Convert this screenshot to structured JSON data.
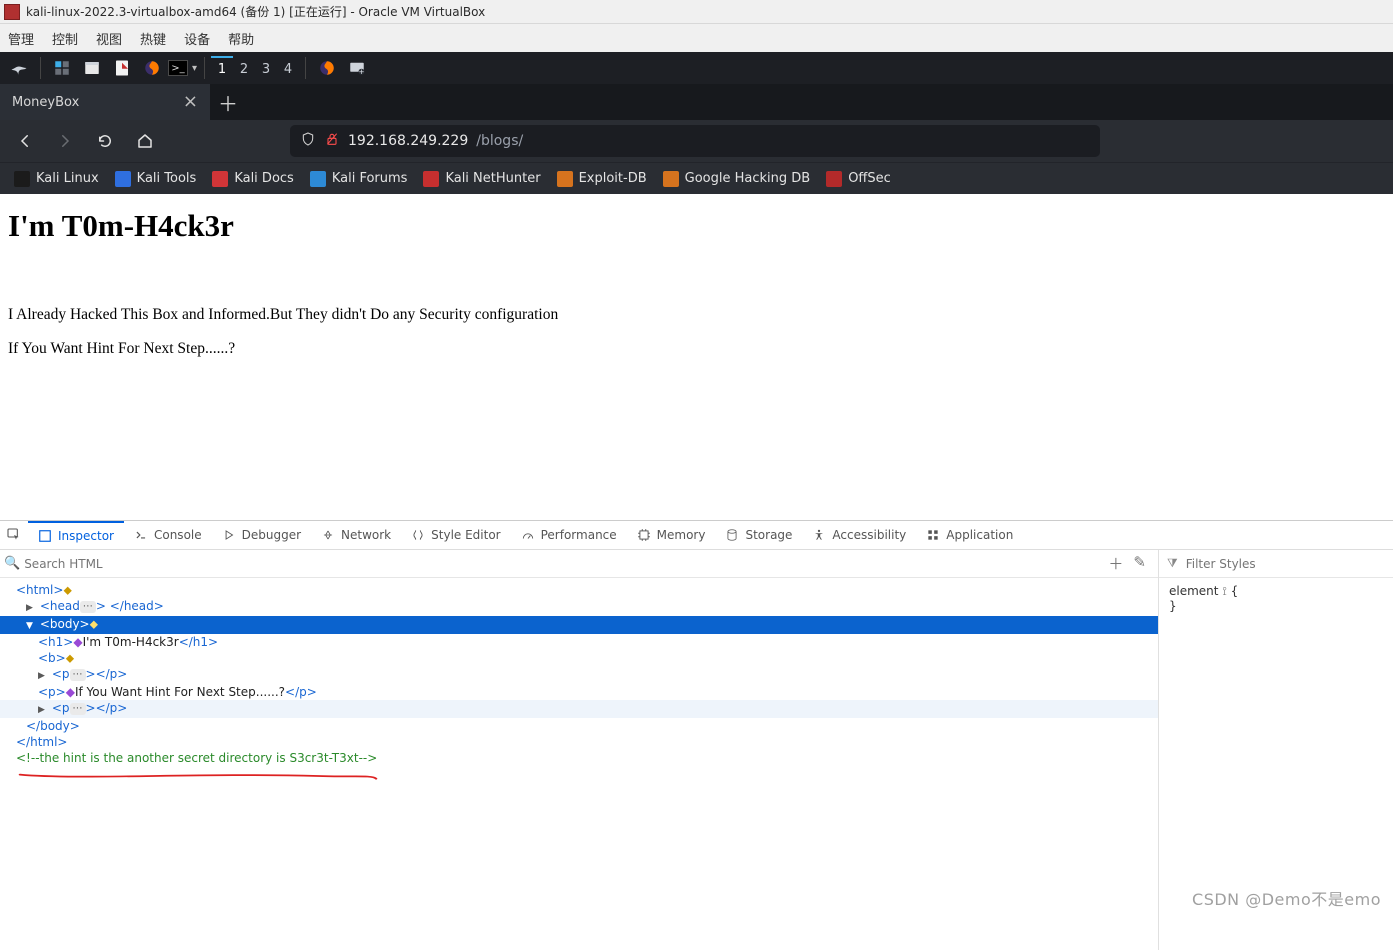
{
  "vm": {
    "title": "kali-linux-2022.3-virtualbox-amd64 (备份 1) [正在运行] - Oracle VM VirtualBox",
    "menus": [
      "管理",
      "控制",
      "视图",
      "热键",
      "设备",
      "帮助"
    ]
  },
  "taskbar": {
    "workspaces": [
      "1",
      "2",
      "3",
      "4"
    ],
    "active_workspace": 0,
    "icons": {
      "kali": "kali-dragon-icon",
      "squares": "activities-icon",
      "files": "file-manager-icon",
      "text": "text-editor-icon",
      "firefox": "firefox-icon",
      "terminal": "terminal-icon",
      "firefox2": "firefox-icon",
      "display": "display-settings-icon"
    },
    "terminal_prompt": ">_"
  },
  "browser": {
    "tab_title": "MoneyBox",
    "url_prefix": "192.168.249.229",
    "url_suffix": "/blogs/",
    "bookmarks": [
      {
        "label": "Kali Linux",
        "color": "#1b1b1b"
      },
      {
        "label": "Kali Tools",
        "color": "#2f6fe0"
      },
      {
        "label": "Kali Docs",
        "color": "#d13538"
      },
      {
        "label": "Kali Forums",
        "color": "#2d8ad6"
      },
      {
        "label": "Kali NetHunter",
        "color": "#c62f2f"
      },
      {
        "label": "Exploit-DB",
        "color": "#d6731e"
      },
      {
        "label": "Google Hacking DB",
        "color": "#d6731e"
      },
      {
        "label": "OffSec",
        "color": "#b32a2a"
      }
    ]
  },
  "page": {
    "heading": "I'm T0m-H4ck3r",
    "p1": "I Already Hacked This Box and Informed.But They didn't Do any Security configuration",
    "p2": "If You Want Hint For Next Step......?"
  },
  "devtools": {
    "tabs": [
      "Inspector",
      "Console",
      "Debugger",
      "Network",
      "Style Editor",
      "Performance",
      "Memory",
      "Storage",
      "Accessibility",
      "Application"
    ],
    "active_tab": 0,
    "search_placeholder": "Search HTML",
    "filter_placeholder": "Filter Styles",
    "dom": {
      "l0": "<html>",
      "l1_open_tag": "<head",
      "l1_close": "</head>",
      "l2_body_open": "<body>",
      "l3_h1": "<h1>I'm T0m-H4ck3r</h1>",
      "l4_b": "<b>",
      "l5_p_open": "<p",
      "l5_p_close": "</p>",
      "l6_p_text": "<p>If You Want Hint For Next Step......?</p>",
      "l7_p_open": "<p",
      "l7_p_close": "</p>",
      "l8_body_close": "</body>",
      "l9_html_close": "</html>",
      "l10_comment": "<!--the hint is the another secret directory is S3cr3t-T3xt-->"
    },
    "styles": {
      "selector_label": "element",
      "rule_open": "{",
      "rule_close": "}"
    }
  },
  "watermark": "CSDN @Demo不是emo"
}
